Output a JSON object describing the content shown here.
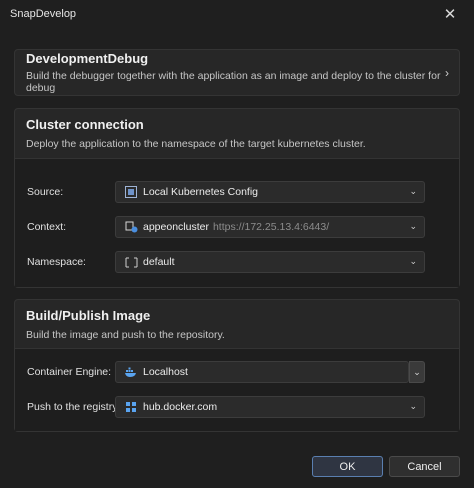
{
  "window": {
    "title": "SnapDevelop"
  },
  "debug_card": {
    "title": "DevelopmentDebug",
    "description": "Build the debugger together with the application as an image and deploy to the cluster for debug"
  },
  "cluster": {
    "title": "Cluster connection",
    "description": "Deploy the application to the namespace of the target kubernetes cluster.",
    "source_label": "Source:",
    "source_value": "Local Kubernetes Config",
    "context_label": "Context:",
    "context_name": "appeoncluster",
    "context_url": "https://172.25.13.4:6443/",
    "namespace_label": "Namespace:",
    "namespace_value": "default"
  },
  "build": {
    "title": "Build/Publish Image",
    "description": "Build the image and push to the repository.",
    "engine_label": "Container Engine:",
    "engine_value": "Localhost",
    "registry_label": "Push to the registry:",
    "registry_value": "hub.docker.com"
  },
  "buttons": {
    "ok": "OK",
    "cancel": "Cancel"
  },
  "icons": [
    "close-icon",
    "chevron-right-icon",
    "kubernetes-config-icon",
    "cluster-icon",
    "namespace-icon",
    "docker-icon",
    "registry-icon",
    "chevron-down-icon"
  ]
}
